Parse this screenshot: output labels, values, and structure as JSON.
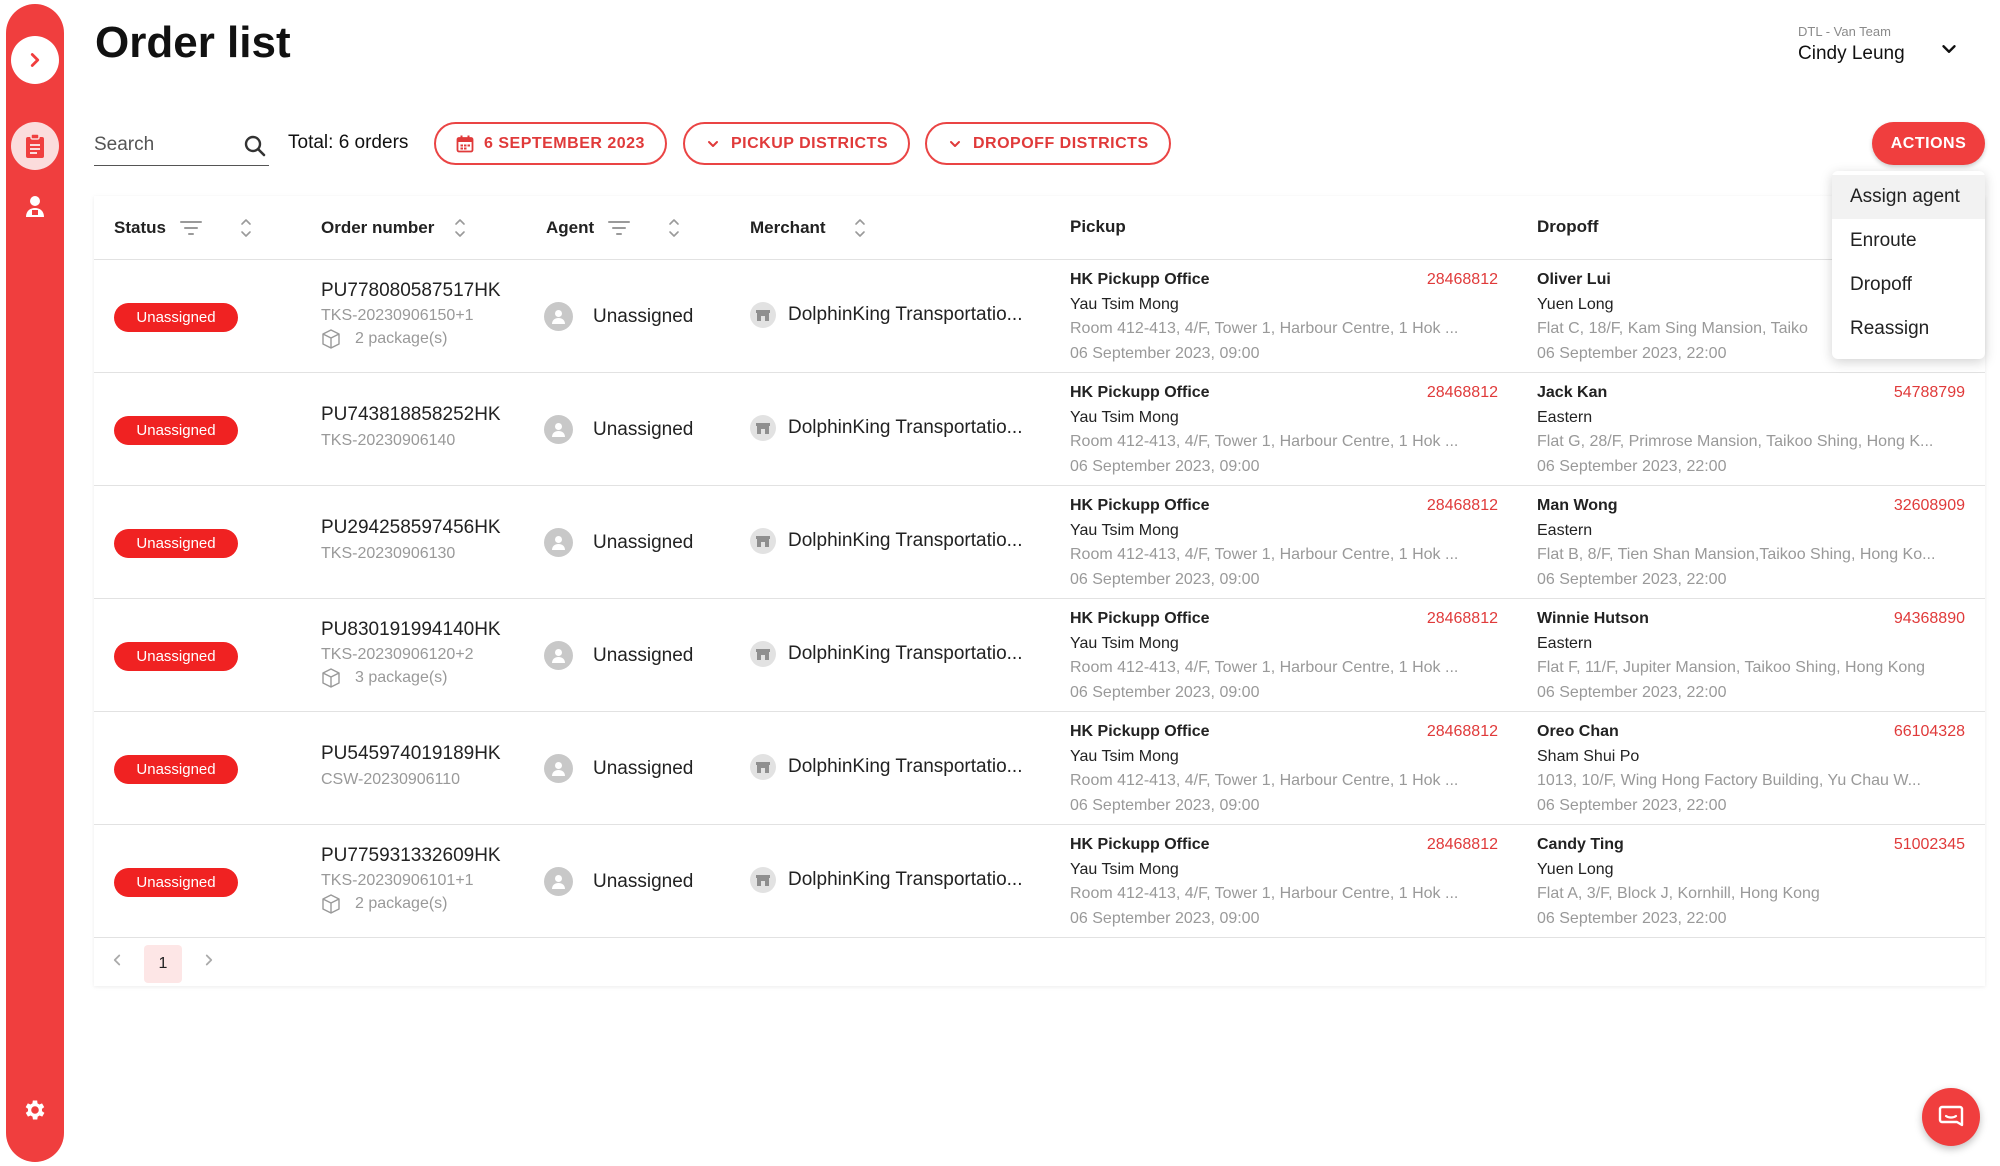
{
  "sidebar": {
    "toggle_icon": "chevron-right-icon",
    "orders_icon": "clipboard-icon",
    "agent_icon": "agent-icon",
    "settings_icon": "gear-icon"
  },
  "header": {
    "title": "Order list",
    "team": "DTL - Van Team",
    "user": "Cindy Leung"
  },
  "toolbar": {
    "search_placeholder": "Search",
    "total": "Total: 6 orders",
    "date": "6 SEPTEMBER 2023",
    "pickup_districts": "PICKUP DISTRICTS",
    "dropoff_districts": "DROPOFF DISTRICTS",
    "actions": "ACTIONS"
  },
  "table": {
    "headers": {
      "status": "Status",
      "order_number": "Order number",
      "agent": "Agent",
      "merchant": "Merchant",
      "pickup": "Pickup",
      "dropoff": "Dropoff"
    },
    "rows": [
      {
        "status": "Unassigned",
        "order_no": "PU778080587517HK",
        "ref": "TKS-20230906150+1",
        "packages": "2 package(s)",
        "agent": "Unassigned",
        "merchant": "DolphinKing Transportatio...",
        "pickup": {
          "name": "HK Pickupp Office",
          "phone": "28468812",
          "district": "Yau Tsim Mong",
          "address": "Room 412-413, 4/F, Tower 1, Harbour Centre, 1 Hok ...",
          "time": "06 September 2023, 09:00"
        },
        "dropoff": {
          "name": "Oliver Lui",
          "phone": "",
          "district": "Yuen Long",
          "address": "Flat C, 18/F, Kam Sing Mansion, Taiko",
          "time": "06 September 2023, 22:00"
        }
      },
      {
        "status": "Unassigned",
        "order_no": "PU743818858252HK",
        "ref": "TKS-20230906140",
        "packages": "",
        "agent": "Unassigned",
        "merchant": "DolphinKing Transportatio...",
        "pickup": {
          "name": "HK Pickupp Office",
          "phone": "28468812",
          "district": "Yau Tsim Mong",
          "address": "Room 412-413, 4/F, Tower 1, Harbour Centre, 1 Hok ...",
          "time": "06 September 2023, 09:00"
        },
        "dropoff": {
          "name": "Jack Kan",
          "phone": "54788799",
          "district": "Eastern",
          "address": "Flat G, 28/F, Primrose Mansion, Taikoo Shing, Hong K...",
          "time": "06 September 2023, 22:00"
        }
      },
      {
        "status": "Unassigned",
        "order_no": "PU294258597456HK",
        "ref": "TKS-20230906130",
        "packages": "",
        "agent": "Unassigned",
        "merchant": "DolphinKing Transportatio...",
        "pickup": {
          "name": "HK Pickupp Office",
          "phone": "28468812",
          "district": "Yau Tsim Mong",
          "address": "Room 412-413, 4/F, Tower 1, Harbour Centre, 1 Hok ...",
          "time": "06 September 2023, 09:00"
        },
        "dropoff": {
          "name": "Man Wong",
          "phone": "32608909",
          "district": "Eastern",
          "address": "Flat B, 8/F, Tien Shan Mansion,Taikoo Shing, Hong Ko...",
          "time": "06 September 2023, 22:00"
        }
      },
      {
        "status": "Unassigned",
        "order_no": "PU830191994140HK",
        "ref": "TKS-20230906120+2",
        "packages": "3 package(s)",
        "agent": "Unassigned",
        "merchant": "DolphinKing Transportatio...",
        "pickup": {
          "name": "HK Pickupp Office",
          "phone": "28468812",
          "district": "Yau Tsim Mong",
          "address": "Room 412-413, 4/F, Tower 1, Harbour Centre, 1 Hok ...",
          "time": "06 September 2023, 09:00"
        },
        "dropoff": {
          "name": "Winnie Hutson",
          "phone": "94368890",
          "district": "Eastern",
          "address": "Flat F, 11/F, Jupiter Mansion, Taikoo Shing, Hong Kong",
          "time": "06 September 2023, 22:00"
        }
      },
      {
        "status": "Unassigned",
        "order_no": "PU545974019189HK",
        "ref": "CSW-20230906110",
        "packages": "",
        "agent": "Unassigned",
        "merchant": "DolphinKing Transportatio...",
        "pickup": {
          "name": "HK Pickupp Office",
          "phone": "28468812",
          "district": "Yau Tsim Mong",
          "address": "Room 412-413, 4/F, Tower 1, Harbour Centre, 1 Hok ...",
          "time": "06 September 2023, 09:00"
        },
        "dropoff": {
          "name": "Oreo Chan",
          "phone": "66104328",
          "district": "Sham Shui Po",
          "address": "1013, 10/F, Wing Hong Factory Building, Yu Chau W...",
          "time": "06 September 2023, 22:00"
        }
      },
      {
        "status": "Unassigned",
        "order_no": "PU775931332609HK",
        "ref": "TKS-20230906101+1",
        "packages": "2 package(s)",
        "agent": "Unassigned",
        "merchant": "DolphinKing Transportatio...",
        "pickup": {
          "name": "HK Pickupp Office",
          "phone": "28468812",
          "district": "Yau Tsim Mong",
          "address": "Room 412-413, 4/F, Tower 1, Harbour Centre, 1 Hok ...",
          "time": "06 September 2023, 09:00"
        },
        "dropoff": {
          "name": "Candy Ting",
          "phone": "51002345",
          "district": "Yuen Long",
          "address": "Flat A, 3/F, Block J, Kornhill, Hong Kong",
          "time": "06 September 2023, 22:00"
        }
      }
    ]
  },
  "pagination": {
    "current": "1"
  },
  "actions_menu": {
    "items": [
      "Assign agent",
      "Enroute",
      "Dropoff",
      "Reassign"
    ],
    "highlighted": "Assign agent"
  },
  "colors": {
    "brand": "#f03e3e",
    "badge": "#f02222",
    "phone": "#e03a3a",
    "muted": "#999999"
  }
}
